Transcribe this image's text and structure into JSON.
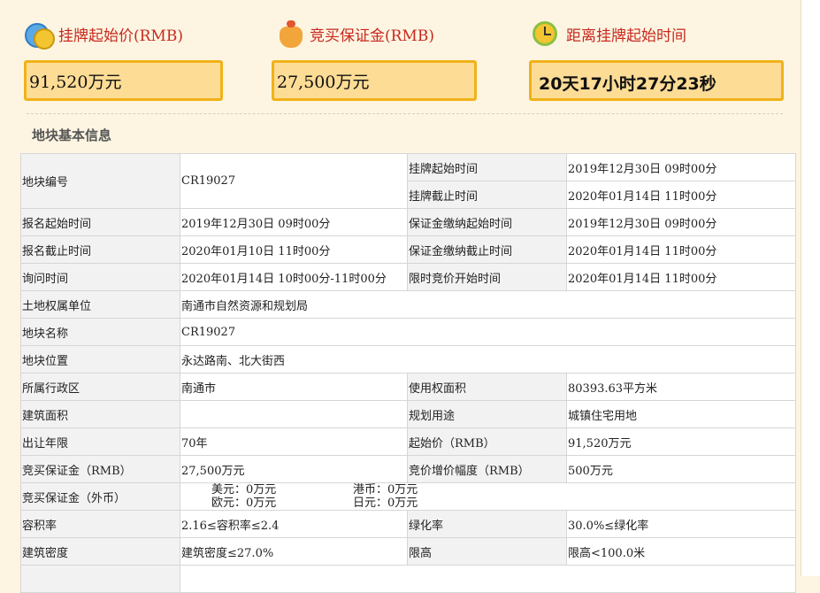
{
  "stats": {
    "start_price": {
      "label": "挂牌起始价(RMB)",
      "value": "91,520万元",
      "icon": "money-icon"
    },
    "deposit": {
      "label": "竞买保证金(RMB)",
      "value": "27,500万元",
      "icon": "money-bag-icon"
    },
    "countdown": {
      "label": "距离挂牌起始时间",
      "value": "20天17小时27分23秒",
      "icon": "alarm-clock-icon"
    }
  },
  "colors": {
    "accent_red": "#c8281f",
    "box_fill": "#fddc95",
    "box_border": "#f0b219",
    "page_bg": "#fdf5e2"
  },
  "section_title": "地块基本信息",
  "table": {
    "r0": {
      "k1": "地块编号",
      "v1": "CR19027",
      "k2": "挂牌起始时间",
      "v2": "2019年12月30日 09时00分"
    },
    "r0b": {
      "k2": "挂牌截止时间",
      "v2": "2020年01月14日 11时00分"
    },
    "r1": {
      "k1": "报名起始时间",
      "v1": "2019年12月30日 09时00分",
      "k2": "保证金缴纳起始时间",
      "v2": "2019年12月30日 09时00分"
    },
    "r2": {
      "k1": "报名截止时间",
      "v1": "2020年01月10日 11时00分",
      "k2": "保证金缴纳截止时间",
      "v2": "2020年01月14日 11时00分"
    },
    "r3": {
      "k1": "询问时间",
      "v1": "2020年01月14日 10时00分-11时00分",
      "k2": "限时竞价开始时间",
      "v2": "2020年01月14日 11时00分"
    },
    "r4": {
      "k1": "土地权属单位",
      "v1": "南通市自然资源和规划局"
    },
    "r5": {
      "k1": "地块名称",
      "v1": "CR19027"
    },
    "r6": {
      "k1": "地块位置",
      "v1": "永达路南、北大街西"
    },
    "r7": {
      "k1": "所属行政区",
      "v1": "南通市",
      "k2": "使用权面积",
      "v2": "80393.63平方米"
    },
    "r8": {
      "k1": "建筑面积",
      "v1": "",
      "k2": "规划用途",
      "v2": "城镇住宅用地"
    },
    "r9": {
      "k1": "出让年限",
      "v1": "70年",
      "k2": "起始价（RMB）",
      "v2": "91,520万元"
    },
    "r10": {
      "k1": "竞买保证金（RMB）",
      "v1": "27,500万元",
      "k2": "竞价增价幅度（RMB）",
      "v2": "500万元"
    },
    "r11": {
      "k1": "竞买保证金（外币）",
      "usd": "美元：0万元",
      "hkd": "港币：0万元",
      "eur": "欧元：0万元",
      "jpy": "日元：0万元"
    },
    "r12": {
      "k1": "容积率",
      "v1": "2.16≤容积率≤2.4",
      "k2": "绿化率",
      "v2": "30.0%≤绿化率"
    },
    "r13": {
      "k1": "建筑密度",
      "v1": "建筑密度≤27.0%",
      "k2": "限高",
      "v2": "限高<100.0米"
    }
  }
}
